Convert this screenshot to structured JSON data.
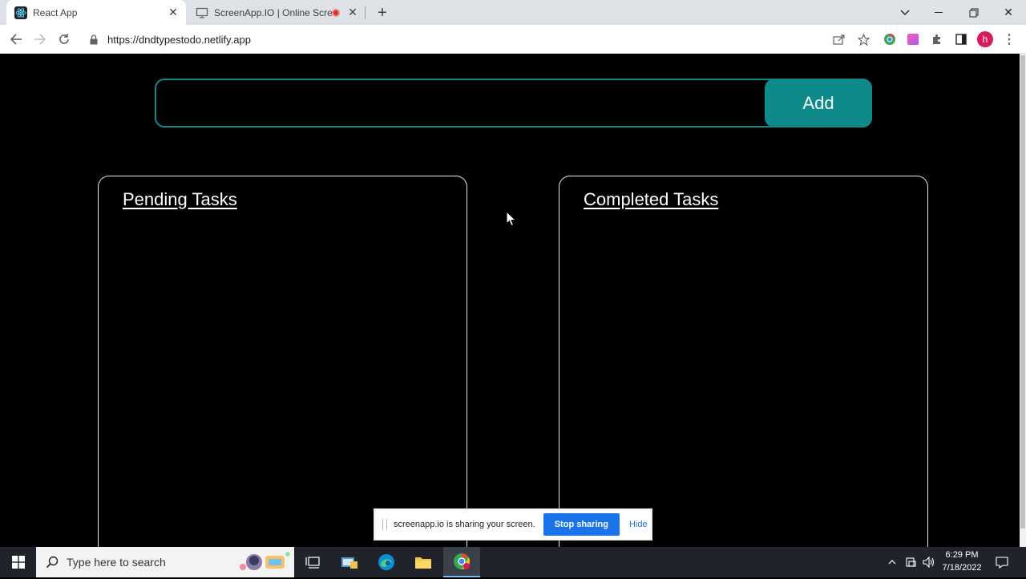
{
  "browser": {
    "tabs": [
      {
        "title": "React App",
        "active": true,
        "icon": "react-icon"
      },
      {
        "title": "ScreenApp.IO | Online Scree",
        "active": false,
        "icon": "monitor-icon",
        "recording": true
      }
    ],
    "url": "https://dndtypestodo.netlify.app",
    "profile_initial": "h"
  },
  "app": {
    "input": {
      "value": "",
      "placeholder": ""
    },
    "add_label": "Add",
    "panels": {
      "pending_title": "Pending Tasks",
      "completed_title": "Completed Tasks"
    },
    "accent_color": "#0f8a8a"
  },
  "share_bar": {
    "message": "screenapp.io is sharing your screen.",
    "stop_label": "Stop sharing",
    "hide_label": "Hide"
  },
  "taskbar": {
    "search_placeholder": "Type here to search",
    "time": "6:29 PM",
    "date": "7/18/2022"
  }
}
